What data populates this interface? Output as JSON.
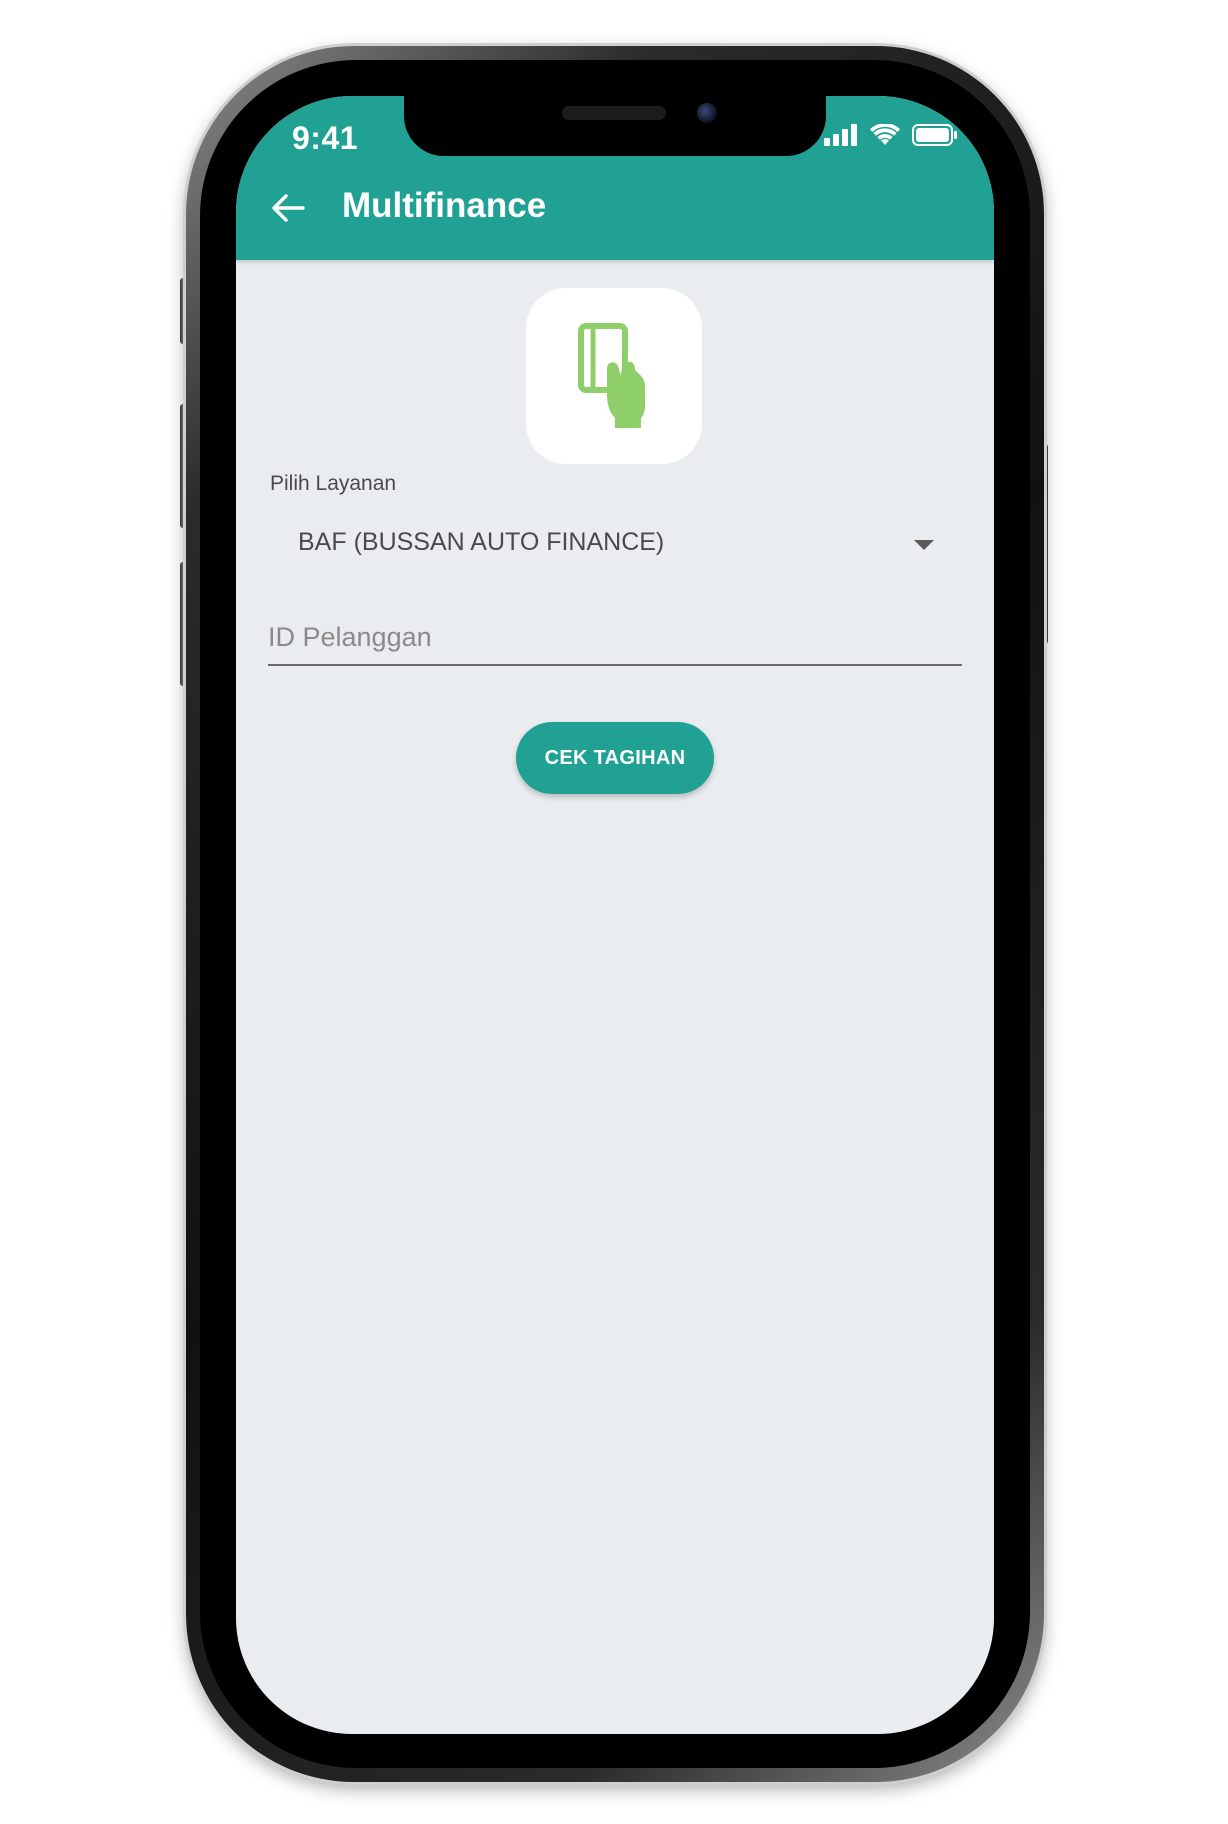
{
  "status_bar": {
    "time": "9:41",
    "icons": [
      "signal-icon",
      "wifi-icon",
      "battery-icon"
    ]
  },
  "app_bar": {
    "title": "Multifinance",
    "back_icon": "arrow-left-icon"
  },
  "logo": {
    "icon": "hand-card-icon",
    "color": "#8fcf6a"
  },
  "form": {
    "service_label": "Pilih Layanan",
    "service_selected": "BAF (BUSSAN AUTO FINANCE)",
    "customer_id_placeholder": "ID Pelanggan",
    "customer_id_value": "",
    "submit_label": "CEK TAGIHAN"
  },
  "colors": {
    "primary": "#21a193",
    "background": "#eaedf0"
  }
}
